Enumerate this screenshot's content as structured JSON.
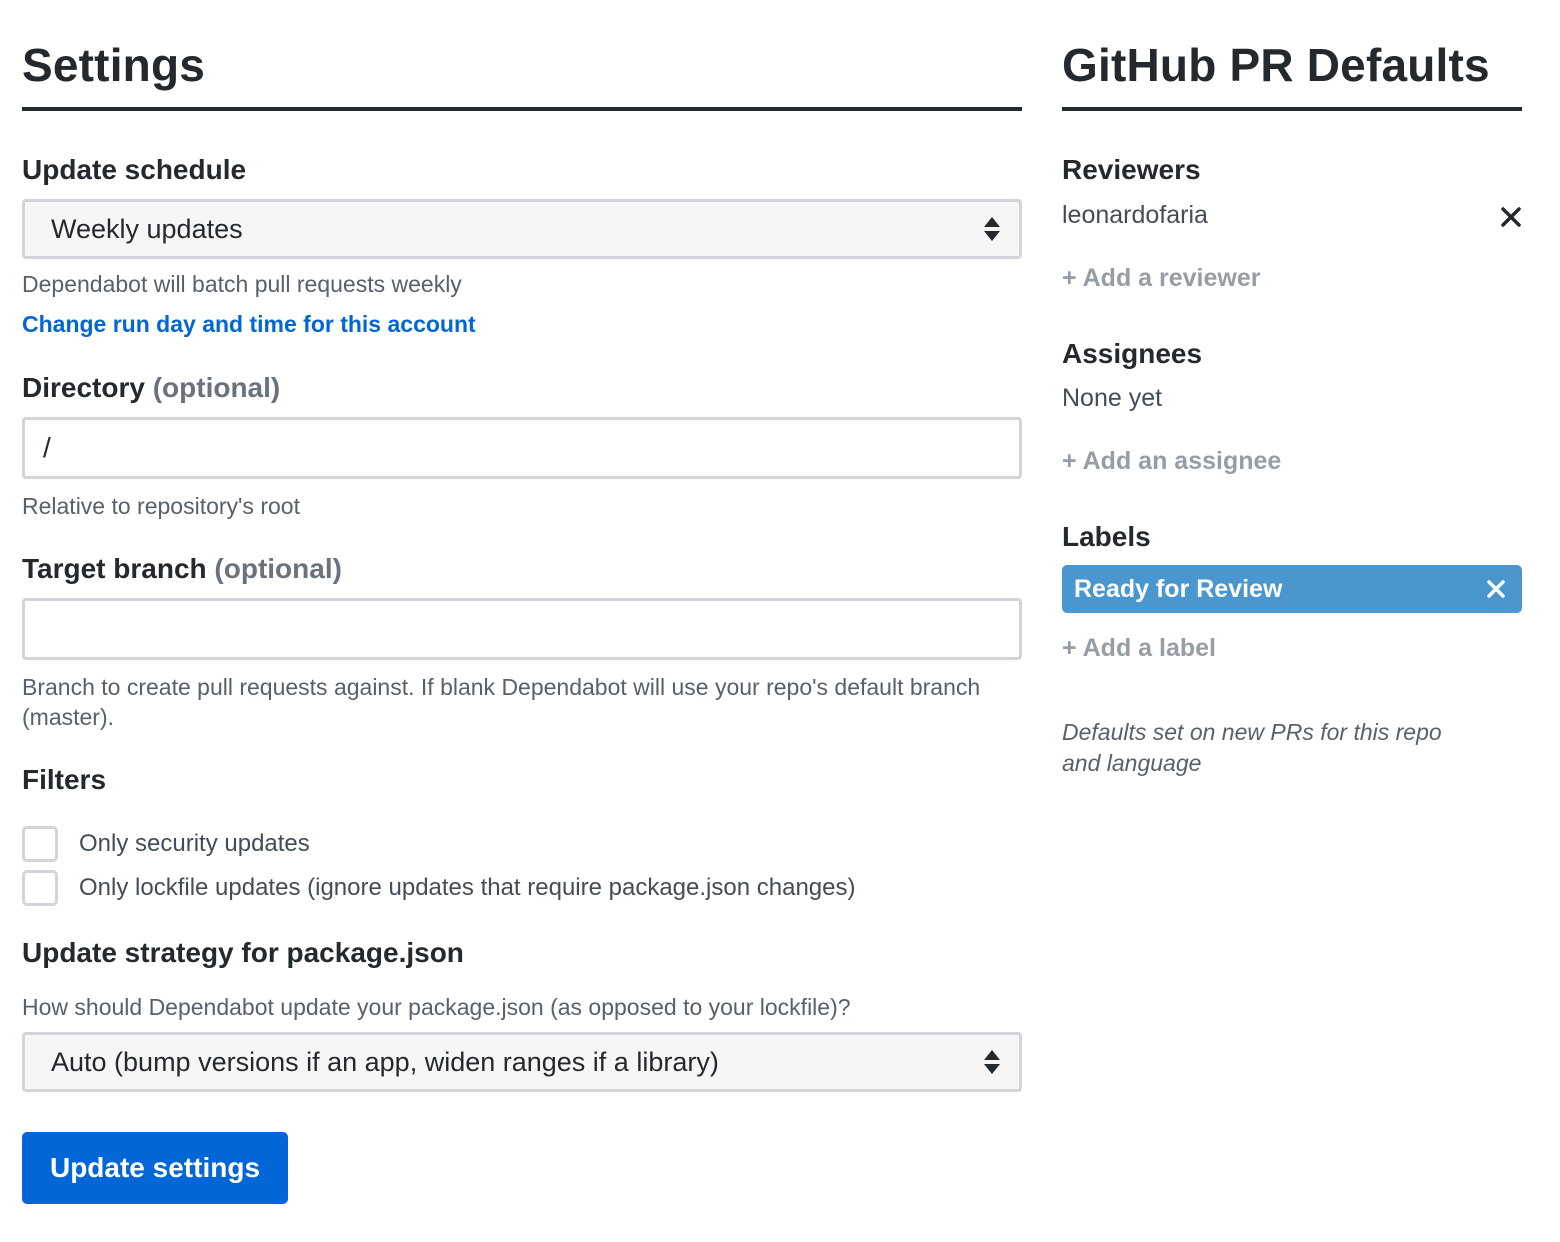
{
  "settings": {
    "title": "Settings",
    "update_schedule": {
      "label": "Update schedule",
      "selected": "Weekly updates",
      "help": "Dependabot will batch pull requests weekly",
      "link": "Change run day and time for this account"
    },
    "directory": {
      "label": "Directory",
      "optional": "(optional)",
      "value": "/",
      "help": "Relative to repository's root"
    },
    "target_branch": {
      "label": "Target branch",
      "optional": "(optional)",
      "value": "",
      "help": "Branch to create pull requests against. If blank Dependabot will use your repo's default branch (master)."
    },
    "filters": {
      "label": "Filters",
      "options": [
        {
          "label": "Only security updates",
          "checked": false
        },
        {
          "label": "Only lockfile updates (ignore updates that require package.json changes)",
          "checked": false
        }
      ]
    },
    "update_strategy": {
      "label": "Update strategy for package.json",
      "help": "How should Dependabot update your package.json (as opposed to your lockfile)?",
      "selected": "Auto (bump versions if an app, widen ranges if a library)"
    },
    "submit_label": "Update settings"
  },
  "pr_defaults": {
    "title": "GitHub PR Defaults",
    "reviewers": {
      "label": "Reviewers",
      "items": [
        "leonardofaria"
      ],
      "add": "+ Add a reviewer"
    },
    "assignees": {
      "label": "Assignees",
      "empty": "None yet",
      "add": "+ Add an assignee"
    },
    "labels": {
      "label": "Labels",
      "items": [
        {
          "name": "Ready for Review",
          "color": "#4a96cf"
        }
      ],
      "add": "+ Add a label"
    },
    "note": "Defaults set on new PRs for this repo and language"
  },
  "colors": {
    "primary": "#0366d6",
    "label_blue": "#4a96cf",
    "text": "#24292e",
    "muted": "#586069"
  }
}
